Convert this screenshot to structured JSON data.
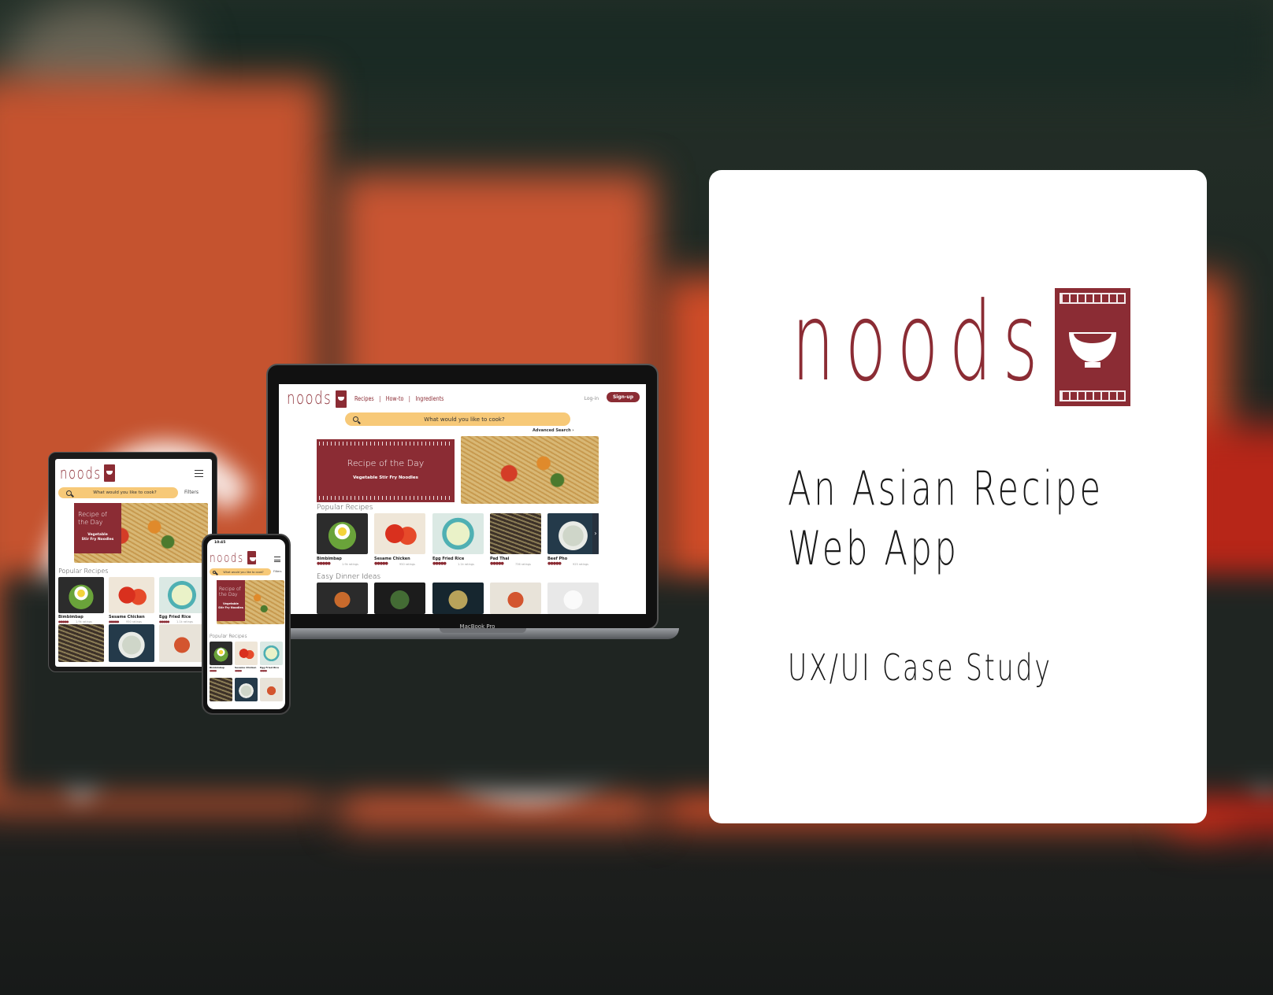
{
  "card": {
    "logo_word": "noods",
    "tagline_line1": "An Asian Recipe",
    "tagline_line2": "Web App",
    "subtitle": "UX/UI Case Study"
  },
  "colors": {
    "brand": "#8b2c34",
    "search_bg": "#f7c978",
    "card_bg": "#ffffff",
    "curtain": "#c5532f"
  },
  "laptop": {
    "device_label": "MacBook Pro",
    "nav": {
      "logo": "noods",
      "links": [
        "Recipes",
        "|",
        "How-to",
        "|",
        "Ingredients"
      ],
      "login": "Log-in",
      "signup": "Sign-up"
    },
    "search": {
      "placeholder": "What would you like to cook?",
      "advanced": "Advanced Search ›"
    },
    "recipe_of_day": {
      "heading": "Recipe of the Day",
      "dish": "Vegetable Stir Fry Noodles"
    },
    "popular": {
      "title": "Popular Recipes",
      "items": [
        {
          "name": "Bimbimbap",
          "stars": "●●●●●",
          "ratings": "1.9k ratings"
        },
        {
          "name": "Sesame Chicken",
          "stars": "●●●●●",
          "ratings": "950 ratings"
        },
        {
          "name": "Egg Fried Rice",
          "stars": "●●●●●",
          "ratings": "1.1k ratings"
        },
        {
          "name": "Pad Thai",
          "stars": "●●●●●",
          "ratings": "736 ratings"
        },
        {
          "name": "Beef Pho",
          "stars": "●●●●●",
          "ratings": "925 ratings"
        }
      ]
    },
    "easy_dinner": {
      "title": "Easy Dinner Ideas"
    },
    "next_arrow": "›"
  },
  "tablet": {
    "logo": "noods",
    "search_placeholder": "What would you like to cook?",
    "filters": "Filters",
    "recipe_of_day": {
      "heading_line1": "Recipe of",
      "heading_line2": "the Day",
      "dish_line1": "Vegetable",
      "dish_line2": "Stir Fry Noodles"
    },
    "popular_title": "Popular Recipes",
    "items": [
      {
        "name": "Bimbimbap",
        "stars": "●●●●●",
        "ratings": "1.9k ratings"
      },
      {
        "name": "Sesame Chicken",
        "stars": "●●●●●",
        "ratings": "950 ratings"
      },
      {
        "name": "Egg Fried Rice",
        "stars": "●●●●●",
        "ratings": "1.1k ratings"
      }
    ]
  },
  "phone": {
    "time": "10:45",
    "logo": "noods",
    "search_placeholder": "What would you like to cook?",
    "filters": "Filters",
    "recipe_of_day": {
      "heading_line1": "Recipe of",
      "heading_line2": "the Day",
      "dish_line1": "Vegetable",
      "dish_line2": "Stir Fry Noodles"
    },
    "popular_title": "Popular Recipes",
    "items": [
      {
        "name": "Bimbimbap",
        "stars": "●●●●●"
      },
      {
        "name": "Sesame Chicken",
        "stars": "●●●●●"
      },
      {
        "name": "Egg Fried Rice",
        "stars": "●●●●●"
      }
    ]
  }
}
